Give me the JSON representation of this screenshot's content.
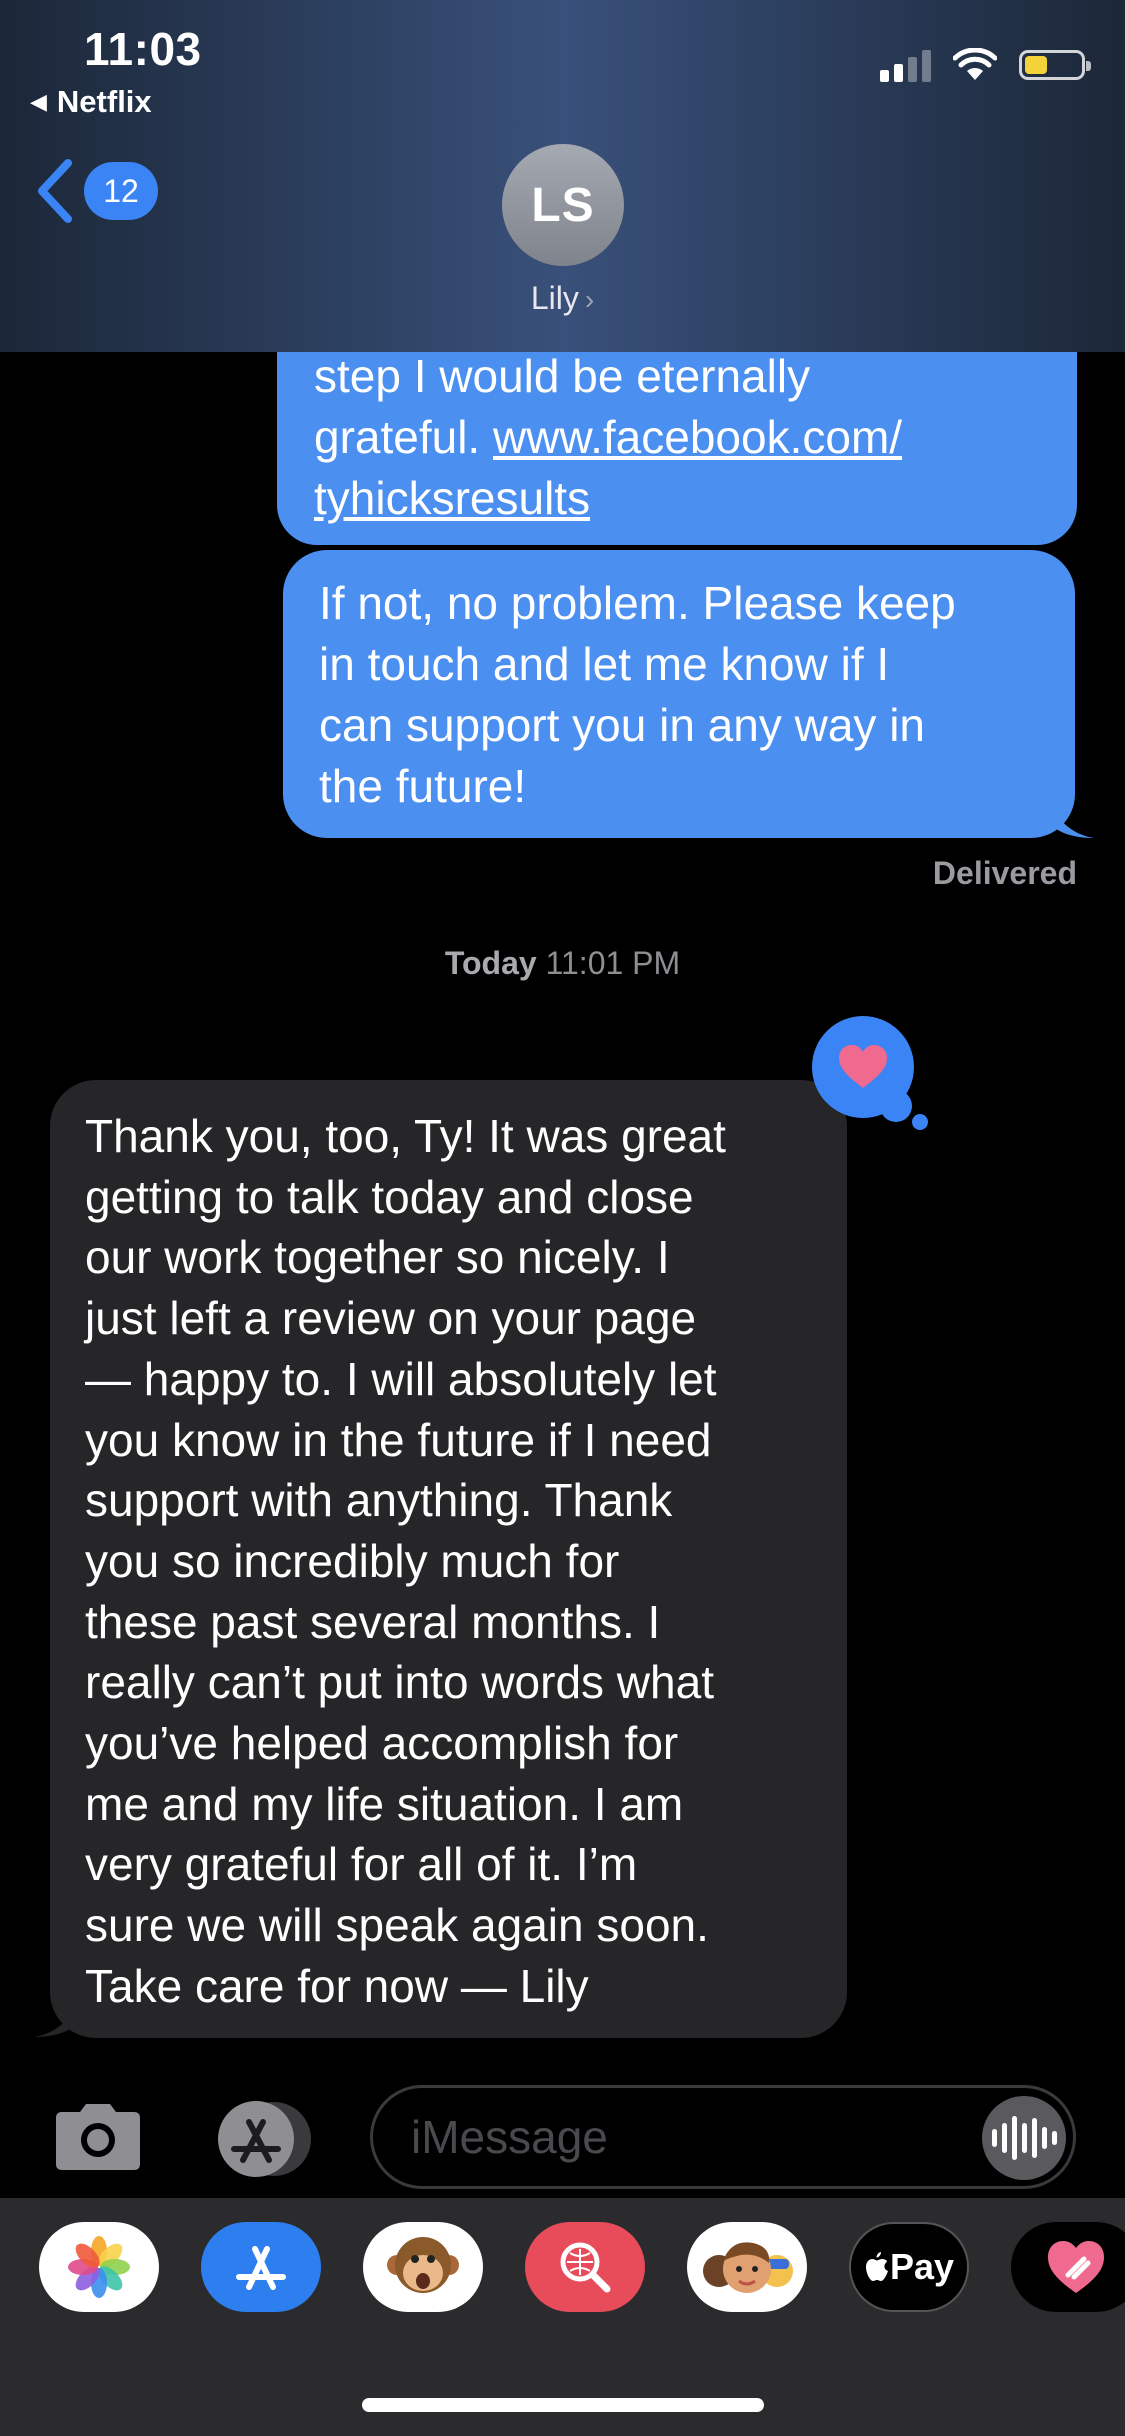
{
  "status_bar": {
    "time": "11:03",
    "back_app": "Netflix",
    "battery_color": "#f4d33a"
  },
  "nav": {
    "unread_count": "12",
    "contact_initials": "LS",
    "contact_name": "Lily"
  },
  "messages": {
    "outgoing_1": {
      "line1": "step I would be eternally",
      "line2_prefix": "grateful. ",
      "link_part1": "www.facebook.com/",
      "link_part2": "tyhicksresults"
    },
    "outgoing_2": {
      "lines": [
        "If not, no problem. Please keep",
        "in touch and let me know if I",
        "can support you in any way in",
        "the future!"
      ]
    },
    "delivered": "Delivered",
    "timestamp": {
      "day": "Today",
      "time": "11:01 PM"
    },
    "incoming_1": {
      "lines": [
        "Thank you, too, Ty! It was great",
        "getting to talk today and close",
        "our work together so nicely. I",
        "just left a review on your page",
        "— happy to. I will absolutely let",
        "you know in the future if I need",
        "support with anything. Thank",
        "you so incredibly much for",
        "these past several months. I",
        "really can’t put into words what",
        "you’ve helped accomplish for",
        "me and my life situation. I am",
        "very grateful for all of it. I’m",
        "sure we will speak again soon.",
        "Take care for now — Lily"
      ],
      "tapback": "heart-icon"
    }
  },
  "input": {
    "placeholder": "iMessage"
  },
  "drawer": {
    "apps": [
      "photos-icon",
      "app-store-icon",
      "animoji-icon",
      "images-search-icon",
      "memoji-icon",
      "apple-pay",
      "digital-touch-icon"
    ],
    "apple_pay_label": "Pay"
  },
  "colors": {
    "outgoing_bubble": "#4b8ff0",
    "incoming_bubble": "#262628",
    "accent": "#3a84f5",
    "tapback_heart": "#f06a8f"
  }
}
